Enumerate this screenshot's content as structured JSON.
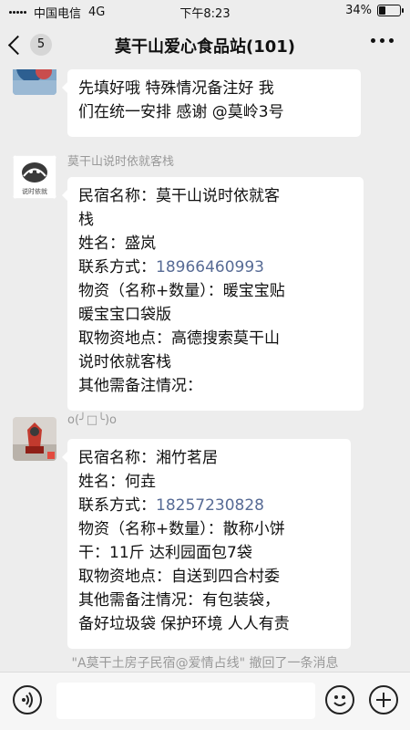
{
  "status_bar": {
    "carrier": "中国电信",
    "network": "4G",
    "time": "下午8:23",
    "battery": "34%",
    "battery_level": 0.34
  },
  "nav": {
    "back_count": "5",
    "title": "莫干山爱心食品站(101)"
  },
  "messages": [
    {
      "sender": "",
      "lines": [
        "先填好哦   特殊情况备注好  我",
        "们在统一安排  感谢 @莫岭3号"
      ]
    },
    {
      "sender": "莫干山说时依就客栈",
      "avatar_text": "说时依就",
      "lines": [
        "民宿名称：莫干山说时依就客",
        "栈",
        "姓名：盛岚",
        "联系方式：",
        "物资（名称+数量）：暖宝宝贴",
        "暖宝宝口袋版",
        "取物资地点：高德搜索莫干山",
        "说时依就客栈",
        "其他需备注情况："
      ],
      "phone": "18966460993"
    },
    {
      "sender": "o(╯□╰)o",
      "lines": [
        "民宿名称：湘竹茗居",
        "姓名：何垚",
        "联系方式：",
        "物资（名称+数量）：散称小饼",
        "干：11斤 达利园面包7袋",
        "取物资地点：自送到四合村委",
        "其他需备注情况：有包装袋，",
        "备好垃圾袋 保护环境 人人有责"
      ],
      "phone": "18257230828"
    }
  ],
  "system_notice": "\"A莫干土房子民宿@爱情占线\" 撤回了一条消息",
  "icons": {
    "back": "chevron-left-icon",
    "more": "more-dots-icon",
    "voice": "voice-icon",
    "emoji": "emoji-icon",
    "plus": "plus-icon"
  },
  "colors": {
    "background": "#ededed",
    "bubble": "#ffffff",
    "link": "#576b95",
    "muted": "#999999"
  }
}
